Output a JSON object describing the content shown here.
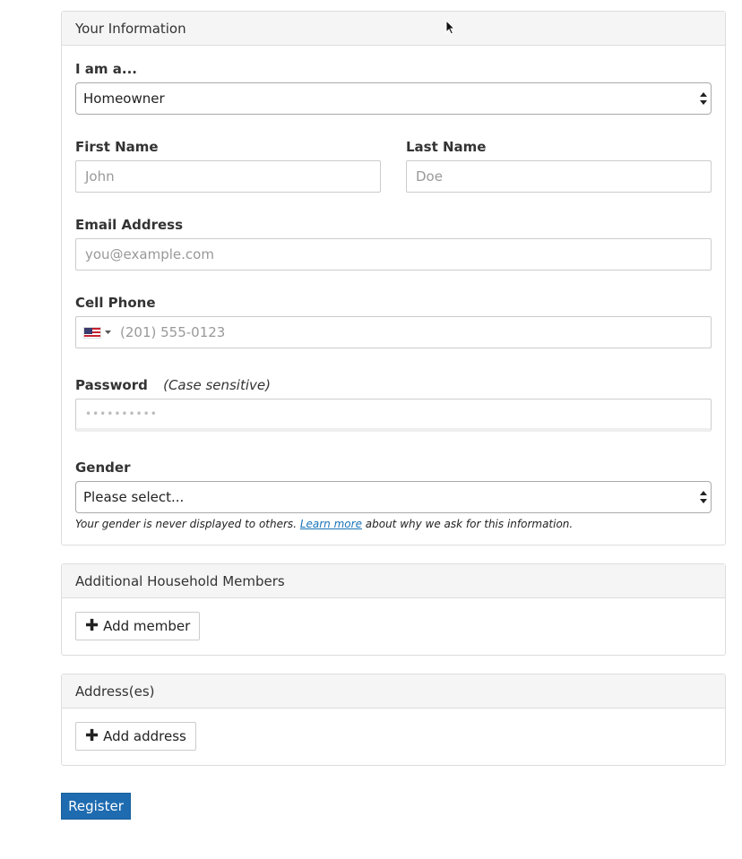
{
  "your_information": {
    "title": "Your Information",
    "role": {
      "label": "I am a...",
      "selected": "Homeowner"
    },
    "first_name": {
      "label": "First Name",
      "placeholder": "John"
    },
    "last_name": {
      "label": "Last Name",
      "placeholder": "Doe"
    },
    "email": {
      "label": "Email Address",
      "placeholder": "you@example.com"
    },
    "cell_phone": {
      "label": "Cell Phone",
      "placeholder": "(201) 555-0123",
      "country_flag": "us-flag-icon"
    },
    "password": {
      "label": "Password",
      "note": "(Case sensitive)",
      "placeholder": "••••••••••"
    },
    "gender": {
      "label": "Gender",
      "selected": "Please select...",
      "help_prefix": "Your gender is never displayed to others. ",
      "help_link": "Learn more",
      "help_suffix": " about why we ask for this information."
    }
  },
  "household": {
    "title": "Additional Household Members",
    "add_label": "Add member"
  },
  "addresses": {
    "title": "Address(es)",
    "add_label": "Add address"
  },
  "register_label": "Register",
  "colors": {
    "primary": "#1e6bb0",
    "link": "#1a73b8",
    "panel_header": "#f5f5f5"
  }
}
